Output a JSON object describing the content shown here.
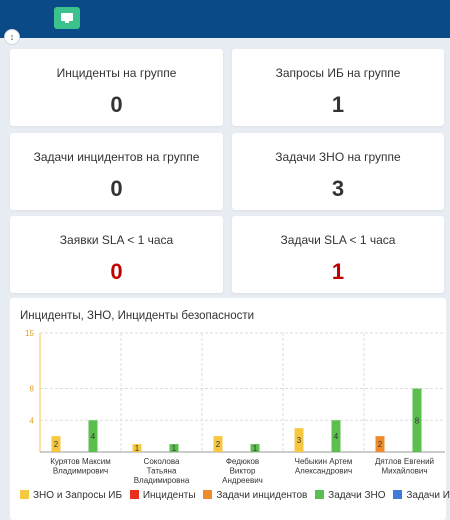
{
  "header": {
    "screen_icon": "monitor-icon",
    "collapse_icon": "expand-collapse-icon"
  },
  "cards": [
    {
      "title": "Инциденты на группе",
      "value": "0",
      "color": "#333333"
    },
    {
      "title": "Запросы ИБ на группе",
      "value": "1",
      "color": "#333333"
    },
    {
      "title": "Задачи инцидентов на группе",
      "value": "0",
      "color": "#333333"
    },
    {
      "title": "Задачи ЗНО на группе",
      "value": "3",
      "color": "#333333"
    },
    {
      "title": "Заявки SLA < 1 часа",
      "value": "0",
      "color": "#c00000"
    },
    {
      "title": "Задачи SLA < 1 часа",
      "value": "1",
      "color": "#c00000"
    }
  ],
  "chart_data": {
    "type": "bar",
    "title": "Инциденты, ЗНО, Инциденты безопасности",
    "categories": [
      [
        "Курятов Максим",
        "Владимирович"
      ],
      [
        "Соколова",
        "Татьяна",
        "Владимировна"
      ],
      [
        "Федюков",
        "Виктор",
        "Андреевич"
      ],
      [
        "Чебыкин Артем",
        "Александрович"
      ],
      [
        "Дятлов Евгений",
        "Михайлович"
      ]
    ],
    "ylim": [
      0,
      15
    ],
    "yticks": [
      "4",
      "8",
      "15"
    ],
    "series": [
      {
        "name": "ЗНО и Запросы ИБ",
        "color": "#f5c842",
        "values": [
          2,
          1,
          2,
          3,
          0
        ]
      },
      {
        "name": "Инциденты",
        "color": "#e8321e",
        "values": [
          0,
          0,
          0,
          0,
          0
        ]
      },
      {
        "name": "Задачи инцидентов",
        "color": "#f08b2c",
        "values": [
          0,
          0,
          0,
          0,
          2
        ]
      },
      {
        "name": "Задачи ЗНО",
        "color": "#5bbf4e",
        "values": [
          4,
          1,
          1,
          4,
          8
        ]
      },
      {
        "name": "Задачи ИБ",
        "color": "#3b7dd8",
        "values": [
          0,
          0,
          0,
          0,
          0
        ]
      }
    ],
    "legend_position": "bottom",
    "grid": true
  }
}
